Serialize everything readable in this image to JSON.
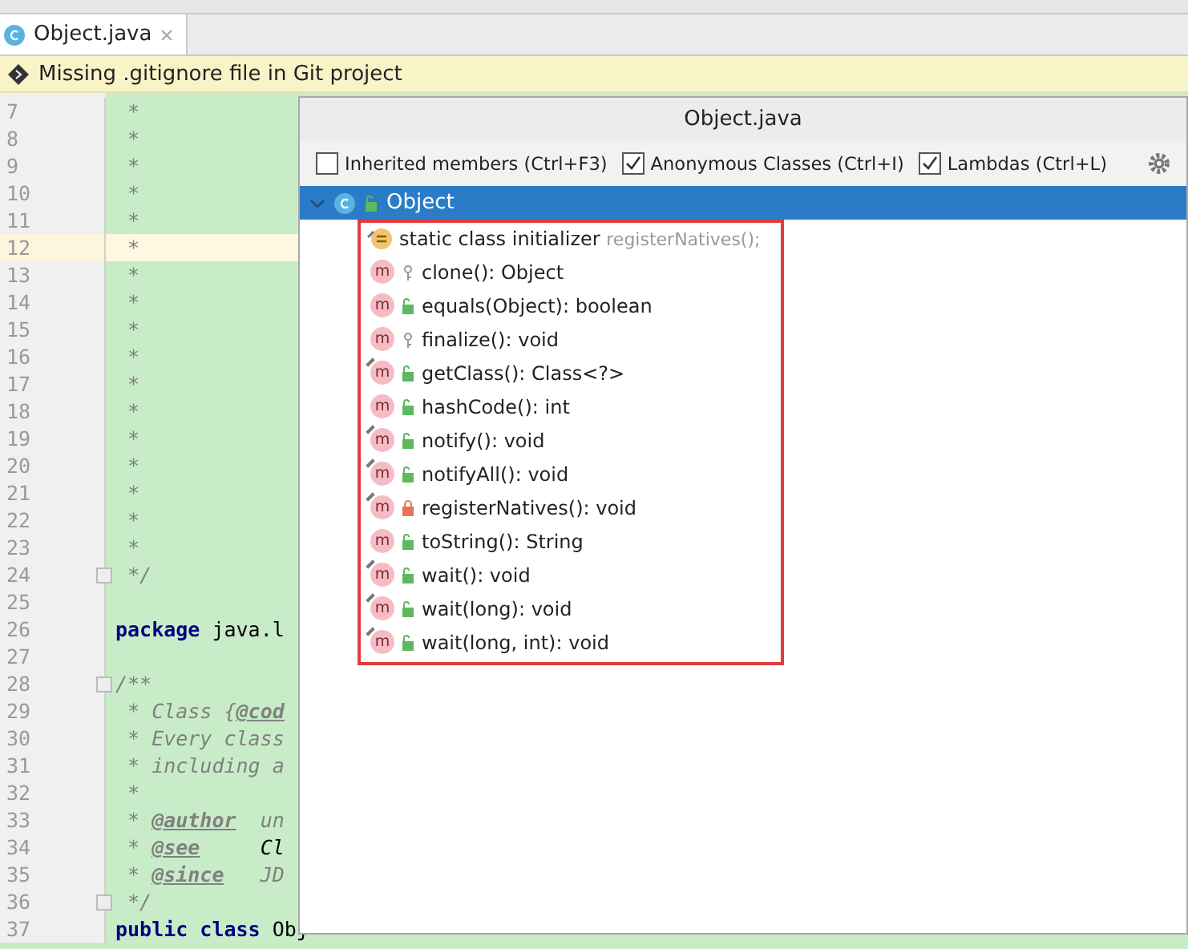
{
  "tabs": [
    {
      "label": "Object.java",
      "selected": true
    }
  ],
  "notification": {
    "text": "Missing .gitignore file in Git project"
  },
  "editor": {
    "lines": [
      {
        "number": "7",
        "current": false,
        "segments": [
          {
            "text": " *",
            "kind": "comment"
          }
        ]
      },
      {
        "number": "8",
        "current": false,
        "segments": [
          {
            "text": " *",
            "kind": "comment"
          }
        ]
      },
      {
        "number": "9",
        "current": false,
        "segments": [
          {
            "text": " *",
            "kind": "comment"
          }
        ]
      },
      {
        "number": "10",
        "current": false,
        "segments": [
          {
            "text": " *",
            "kind": "comment"
          }
        ]
      },
      {
        "number": "11",
        "current": false,
        "segments": [
          {
            "text": " *",
            "kind": "comment"
          }
        ]
      },
      {
        "number": "12",
        "current": true,
        "segments": [
          {
            "text": " *",
            "kind": "comment"
          }
        ]
      },
      {
        "number": "13",
        "current": false,
        "segments": [
          {
            "text": " *",
            "kind": "comment"
          }
        ]
      },
      {
        "number": "14",
        "current": false,
        "segments": [
          {
            "text": " *",
            "kind": "comment"
          }
        ]
      },
      {
        "number": "15",
        "current": false,
        "segments": [
          {
            "text": " *",
            "kind": "comment"
          }
        ]
      },
      {
        "number": "16",
        "current": false,
        "segments": [
          {
            "text": " *",
            "kind": "comment"
          }
        ]
      },
      {
        "number": "17",
        "current": false,
        "segments": [
          {
            "text": " *",
            "kind": "comment"
          }
        ]
      },
      {
        "number": "18",
        "current": false,
        "segments": [
          {
            "text": " *",
            "kind": "comment"
          }
        ]
      },
      {
        "number": "19",
        "current": false,
        "segments": [
          {
            "text": " *",
            "kind": "comment"
          }
        ]
      },
      {
        "number": "20",
        "current": false,
        "segments": [
          {
            "text": " *",
            "kind": "comment"
          }
        ]
      },
      {
        "number": "21",
        "current": false,
        "segments": [
          {
            "text": " *",
            "kind": "comment"
          }
        ]
      },
      {
        "number": "22",
        "current": false,
        "segments": [
          {
            "text": " *",
            "kind": "comment"
          }
        ]
      },
      {
        "number": "23",
        "current": false,
        "segments": [
          {
            "text": " *",
            "kind": "comment"
          }
        ]
      },
      {
        "number": "24",
        "current": false,
        "fold": true,
        "segments": [
          {
            "text": " */",
            "kind": "comment"
          }
        ]
      },
      {
        "number": "25",
        "current": false
      },
      {
        "number": "26",
        "current": false,
        "segments": [
          {
            "text": "package",
            "kind": "keyword"
          },
          {
            "text": " java.l",
            "kind": "plain"
          }
        ]
      },
      {
        "number": "27",
        "current": false
      },
      {
        "number": "28",
        "current": false,
        "fold": true,
        "segments": [
          {
            "text": "/**",
            "kind": "comment"
          }
        ]
      },
      {
        "number": "29",
        "current": false,
        "segments": [
          {
            "text": " * Class {",
            "kind": "comment"
          },
          {
            "text": "@cod",
            "kind": "tag"
          }
        ]
      },
      {
        "number": "30",
        "current": false,
        "segments": [
          {
            "text": " * Every class",
            "kind": "comment"
          }
        ]
      },
      {
        "number": "31",
        "current": false,
        "segments": [
          {
            "text": " * including a",
            "kind": "comment"
          }
        ]
      },
      {
        "number": "32",
        "current": false,
        "segments": [
          {
            "text": " *",
            "kind": "comment"
          }
        ]
      },
      {
        "number": "33",
        "current": false,
        "segments": [
          {
            "text": " * ",
            "kind": "comment"
          },
          {
            "text": "@author",
            "kind": "tag"
          },
          {
            "text": "  un",
            "kind": "comment"
          }
        ]
      },
      {
        "number": "34",
        "current": false,
        "segments": [
          {
            "text": " * ",
            "kind": "comment"
          },
          {
            "text": "@see",
            "kind": "tag"
          },
          {
            "text": "     Cl",
            "kind": "docref"
          }
        ]
      },
      {
        "number": "35",
        "current": false,
        "segments": [
          {
            "text": " * ",
            "kind": "comment"
          },
          {
            "text": "@since",
            "kind": "tag"
          },
          {
            "text": "   JD",
            "kind": "comment"
          }
        ]
      },
      {
        "number": "36",
        "current": false,
        "fold": true,
        "segments": [
          {
            "text": " */",
            "kind": "comment"
          }
        ]
      },
      {
        "number": "37",
        "current": false,
        "segments": [
          {
            "text": "public class",
            "kind": "keyword"
          },
          {
            "text": " Obj",
            "kind": "plain"
          }
        ]
      }
    ]
  },
  "structure_popup": {
    "title": "Object.java",
    "options": [
      {
        "label": "Inherited members (Ctrl+F3)",
        "checked": false
      },
      {
        "label": "Anonymous Classes (Ctrl+I)",
        "checked": true
      },
      {
        "label": "Lambdas (Ctrl+L)",
        "checked": true
      }
    ],
    "root": {
      "label": "Object",
      "expanded": true,
      "selected": true
    },
    "members": [
      {
        "kind": "initializer",
        "native": true,
        "label": "static class initializer",
        "hint": "registerNatives();"
      },
      {
        "kind": "method",
        "badge": "m",
        "protected": true,
        "private": false,
        "native": false,
        "label": "clone(): Object"
      },
      {
        "kind": "method",
        "badge": "m",
        "protected": false,
        "private": false,
        "native": false,
        "label": "equals(Object): boolean"
      },
      {
        "kind": "method",
        "badge": "m",
        "protected": true,
        "private": false,
        "native": false,
        "label": "finalize(): void"
      },
      {
        "kind": "method",
        "badge": "m",
        "protected": false,
        "private": false,
        "native": true,
        "label": "getClass(): Class<?>"
      },
      {
        "kind": "method",
        "badge": "m",
        "protected": false,
        "private": false,
        "native": false,
        "label": "hashCode(): int"
      },
      {
        "kind": "method",
        "badge": "m",
        "protected": false,
        "private": false,
        "native": true,
        "label": "notify(): void"
      },
      {
        "kind": "method",
        "badge": "m",
        "protected": false,
        "private": false,
        "native": true,
        "label": "notifyAll(): void"
      },
      {
        "kind": "method",
        "badge": "m",
        "protected": false,
        "private": true,
        "native": true,
        "label": "registerNatives(): void"
      },
      {
        "kind": "method",
        "badge": "m",
        "protected": false,
        "private": false,
        "native": false,
        "label": "toString(): String"
      },
      {
        "kind": "method",
        "badge": "m",
        "protected": false,
        "private": false,
        "native": true,
        "label": "wait(): void"
      },
      {
        "kind": "method",
        "badge": "m",
        "protected": false,
        "private": false,
        "native": true,
        "label": "wait(long): void"
      },
      {
        "kind": "method",
        "badge": "m",
        "protected": false,
        "private": false,
        "native": true,
        "label": "wait(long, int): void"
      }
    ]
  }
}
